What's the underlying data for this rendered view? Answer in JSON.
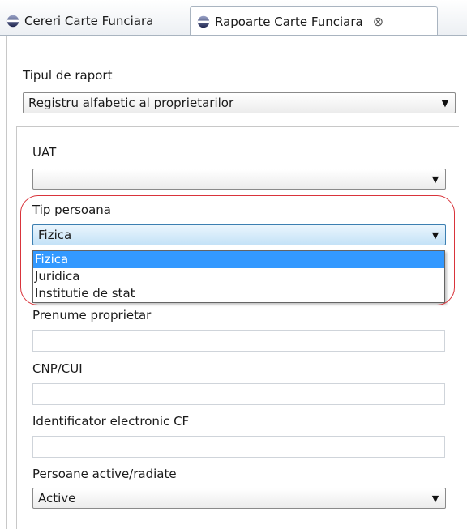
{
  "tabs": [
    {
      "label": "Cereri Carte Funciara",
      "icon": "eclipse-sphere-icon"
    },
    {
      "label": "Rapoarte Carte Funciara",
      "icon": "eclipse-sphere-icon",
      "close_glyph": "⊗",
      "active": true
    }
  ],
  "form": {
    "report_type": {
      "label": "Tipul de raport",
      "value": "Registru alfabetic al proprietarilor"
    },
    "uat": {
      "label": "UAT",
      "value": ""
    },
    "person_type": {
      "label": "Tip persoana",
      "value": "Fizica",
      "options": [
        "Fizica",
        "Juridica",
        "Institutie de stat"
      ],
      "selected_index": 0,
      "expanded": true
    },
    "owner_first_name": {
      "label": "Prenume proprietar",
      "value": ""
    },
    "cnp_cui": {
      "label": "CNP/CUI",
      "value": ""
    },
    "cf_electronic_id": {
      "label": "Identificator electronic CF",
      "value": ""
    },
    "persons_status": {
      "label": "Persoane active/radiate",
      "value": "Active"
    }
  },
  "dropdown_arrow_glyph": "▼",
  "colors": {
    "selection": "#3399ff",
    "annotation_outline": "#d9343b",
    "active_combo": "#c4e2f7",
    "tab_icon_dark": "#1f2650",
    "tab_icon_light": "#9aa3c8"
  }
}
